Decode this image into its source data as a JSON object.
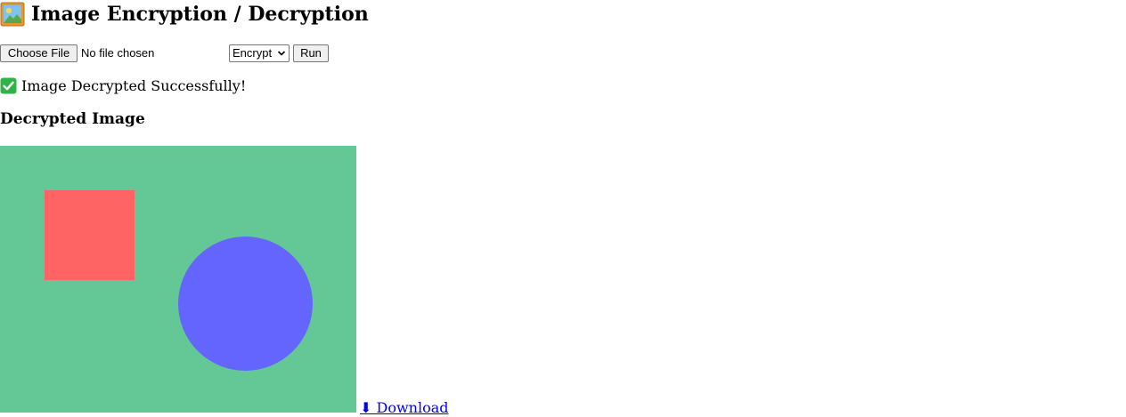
{
  "header": {
    "title_icon": "framed-picture-icon",
    "title": "Image Encryption / Decryption"
  },
  "controls": {
    "file_button_label": "Choose File",
    "file_status": "No file chosen",
    "mode_select": {
      "selected": "Encrypt"
    },
    "run_label": "Run"
  },
  "status": {
    "icon": "check-mark-icon",
    "icon_color": "#2fb344",
    "message": "Image Decrypted Successfully!"
  },
  "result": {
    "heading": "Decrypted Image",
    "image": {
      "background_color": "#64c896",
      "square_color": "#ff6464",
      "circle_color": "#6464ff"
    },
    "download_label": "⬇ Download",
    "link_color": "#0000ee"
  }
}
